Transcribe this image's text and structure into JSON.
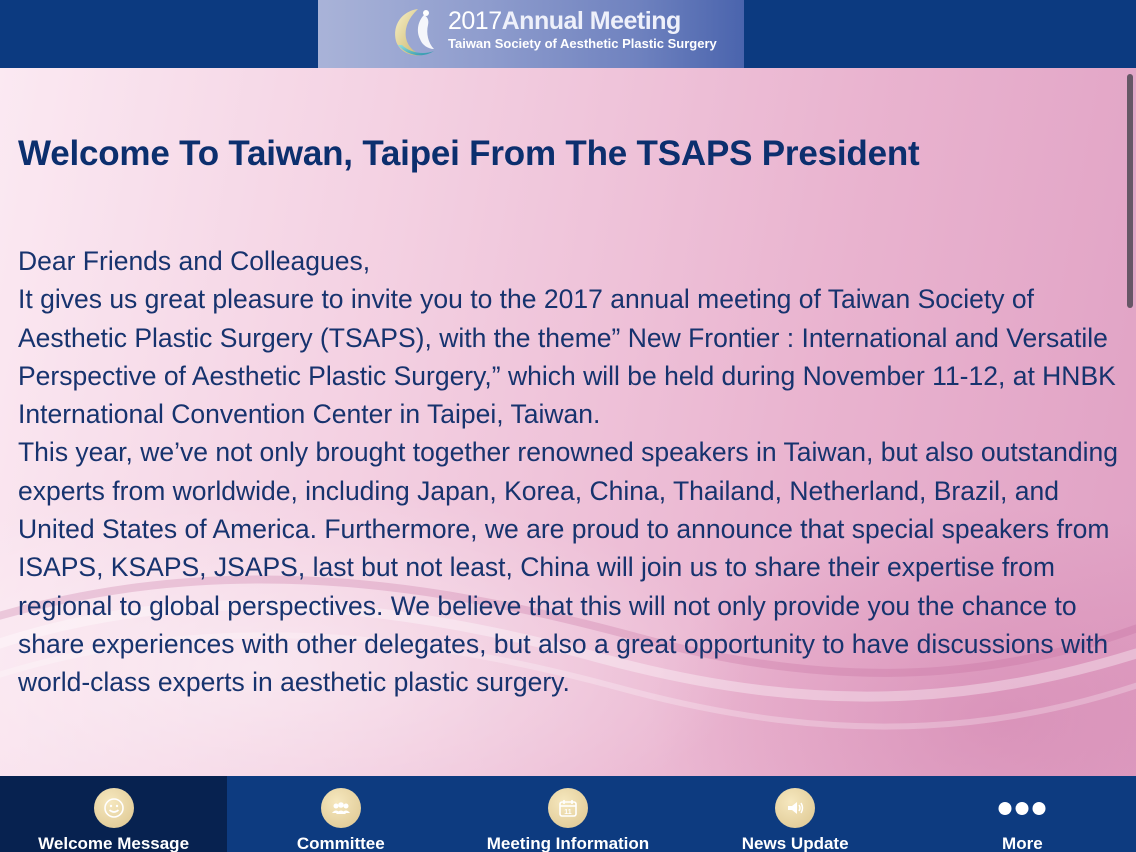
{
  "header": {
    "year": "2017",
    "meeting": "Annual Meeting",
    "society": "Taiwan Society of Aesthetic Plastic Surgery"
  },
  "content": {
    "title": "Welcome To Taiwan, Taipei From The TSAPS President",
    "paragraphs": [
      "Dear Friends and Colleagues,",
      "It gives us great pleasure to invite you to the 2017 annual meeting of Taiwan Society of Aesthetic Plastic Surgery (TSAPS), with the theme” New Frontier : International and Versatile Perspective of Aesthetic Plastic Surgery,” which will be held during November 11-12, at HNBK International Convention Center in Taipei, Taiwan.",
      "This year, we’ve not only brought together renowned speakers in Taiwan, but also outstanding experts from worldwide, including Japan, Korea, China, Thailand, Netherland, Brazil, and United States of America. Furthermore, we are proud to announce that special speakers from ISAPS, KSAPS, JSAPS, last but not least, China will join us to share their expertise from regional to global perspectives. We believe that this will not only provide you the chance to share experiences with other delegates, but also a great opportunity to have discussions with world-class experts in aesthetic plastic surgery."
    ]
  },
  "tabs": [
    {
      "label": "Welcome Message",
      "icon": "smiley-icon",
      "active": true
    },
    {
      "label": "Committee",
      "icon": "people-icon",
      "active": false
    },
    {
      "label": "Meeting Information",
      "icon": "calendar-icon",
      "active": false
    },
    {
      "label": "News Update",
      "icon": "speaker-icon",
      "active": false
    },
    {
      "label": "More",
      "icon": "more-dots-icon",
      "active": false
    }
  ],
  "colors": {
    "header_bg": "#0c3a80",
    "tabbar_bg": "#0d3b80",
    "tab_active_bg": "#072250",
    "title_text": "#0c2f6e",
    "body_text": "#17336e",
    "icon_gold": "#dcc58f"
  }
}
